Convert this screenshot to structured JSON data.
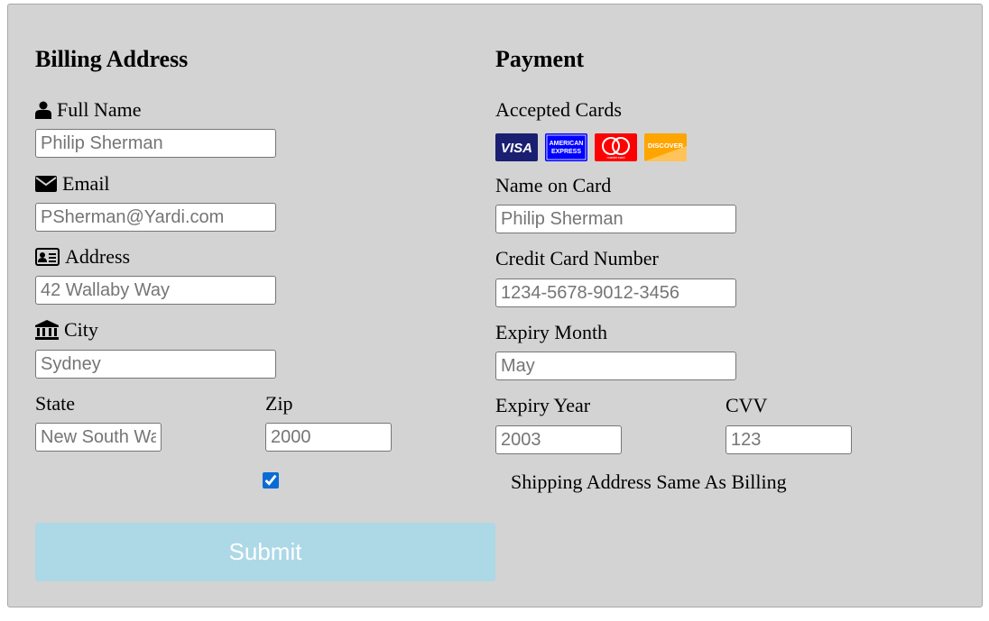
{
  "billing": {
    "heading": "Billing Address",
    "full_name_label": "Full Name",
    "full_name_placeholder": "Philip Sherman",
    "email_label": "Email",
    "email_placeholder": "PSherman@Yardi.com",
    "address_label": "Address",
    "address_placeholder": "42 Wallaby Way",
    "city_label": "City",
    "city_placeholder": "Sydney",
    "state_label": "State",
    "state_placeholder": "New South Wales",
    "zip_label": "Zip",
    "zip_placeholder": "2000"
  },
  "payment": {
    "heading": "Payment",
    "accepted_cards_label": "Accepted Cards",
    "cards": [
      {
        "name": "VISA",
        "color": "#1a1f71"
      },
      {
        "name": "AMERICAN EXPRESS",
        "color": "#0000ff"
      },
      {
        "name": "mastercard",
        "color": "#ff0000"
      },
      {
        "name": "DISCOVER",
        "color": "#ffa500"
      }
    ],
    "name_on_card_label": "Name on Card",
    "name_on_card_placeholder": "Philip Sherman",
    "card_number_label": "Credit Card Number",
    "card_number_placeholder": "1234-5678-9012-3456",
    "expiry_month_label": "Expiry Month",
    "expiry_month_placeholder": "May",
    "expiry_year_label": "Expiry Year",
    "expiry_year_placeholder": "2003",
    "cvv_label": "CVV",
    "cvv_placeholder": "123"
  },
  "shipping_same": {
    "checked": true,
    "label": "Shipping Address Same As Billing"
  },
  "submit_label": "Submit",
  "colors": {
    "panel_bg": "#d3d3d3",
    "submit_bg": "#add8e6",
    "checkbox": "#0b6bd6"
  }
}
